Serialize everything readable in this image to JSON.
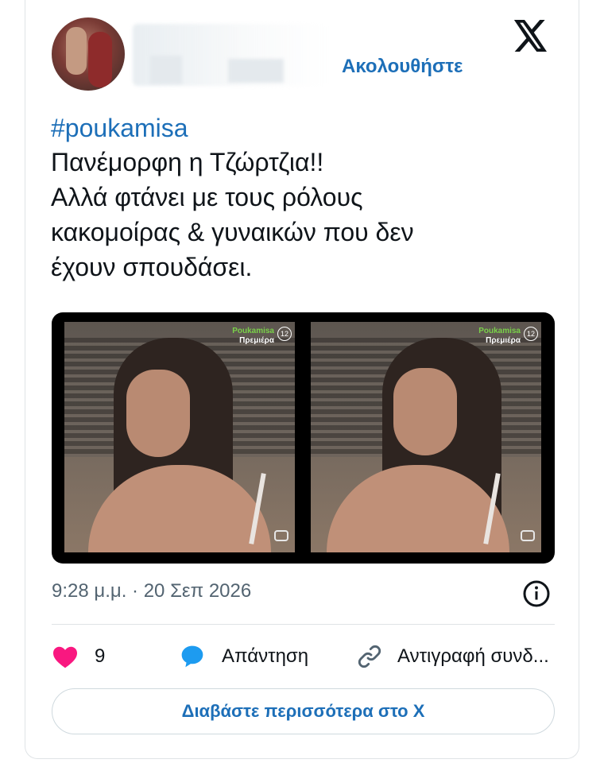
{
  "header": {
    "follow_label": "Ακολουθήστε",
    "logo_icon": "x-logo-icon",
    "avatar_icon": "avatar"
  },
  "tweet": {
    "hashtag": "#poukamisa",
    "lines": [
      "Πανέμορφη η Τζώρτζια!!",
      "Αλλά φτάνει με τους ρόλους",
      "κακομοίρας & γυναικών που δεν",
      "έχουν σπουδάσει."
    ]
  },
  "media": {
    "watermark_brand": "Poukamisa",
    "watermark_sub": "Πρεμιέρα",
    "rating": "12"
  },
  "meta": {
    "timestamp": "9:28 μ.μ. · 20 Σεπ 2026"
  },
  "actions": {
    "likes_count": "9",
    "reply_label": "Απάντηση",
    "copy_link_label": "Αντιγραφή συνδ..."
  },
  "footer": {
    "read_more_label": "Διαβάστε περισσότερα στο X"
  },
  "colors": {
    "accent": "#1d6fb8",
    "like": "#f91880",
    "reply": "#1d9bf0",
    "muted": "#536471"
  }
}
